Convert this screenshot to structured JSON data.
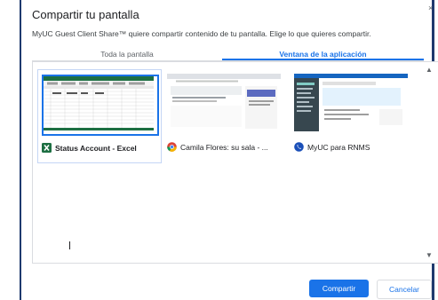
{
  "dialog": {
    "title": "Compartir tu pantalla",
    "subtitle": "MyUC Guest Client Share™ quiere compartir contenido de tu pantalla. Elige lo que quieres compartir.",
    "close_glyph": "×"
  },
  "tabs": [
    {
      "label": "Toda la pantalla",
      "selected": false
    },
    {
      "label": "Ventana de la aplicación",
      "selected": true
    }
  ],
  "windows": [
    {
      "label": "Status Account - Excel",
      "icon": "excel-icon",
      "selected": true
    },
    {
      "label": "Camila Flores: su sala - ...",
      "icon": "chrome-icon",
      "selected": false
    },
    {
      "label": "MyUC para RNMS",
      "icon": "myuc-icon",
      "selected": false
    }
  ],
  "buttons": {
    "share": "Compartir",
    "cancel": "Cancelar"
  },
  "colors": {
    "accent": "#1a73e8",
    "excel_green": "#1d6f42",
    "frame_blue": "#1f3a6e"
  }
}
